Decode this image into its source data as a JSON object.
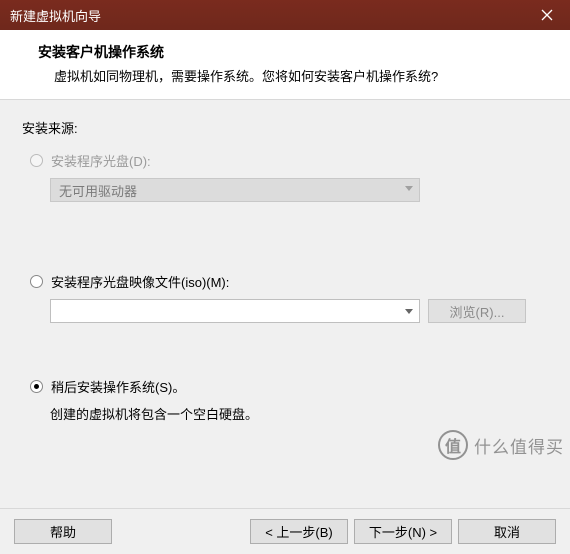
{
  "window": {
    "title": "新建虚拟机向导"
  },
  "header": {
    "title": "安装客户机操作系统",
    "subtitle": "虚拟机如同物理机，需要操作系统。您将如何安装客户机操作系统?"
  },
  "source_label": "安装来源:",
  "options": {
    "disc": {
      "label": "安装程序光盘(D):",
      "dropdown": "无可用驱动器",
      "enabled": false,
      "selected": false
    },
    "iso": {
      "label": "安装程序光盘映像文件(iso)(M):",
      "value": "",
      "browse": "浏览(R)...",
      "selected": false
    },
    "later": {
      "label": "稍后安装操作系统(S)。",
      "hint": "创建的虚拟机将包含一个空白硬盘。",
      "selected": true
    }
  },
  "footer": {
    "help": "帮助",
    "back": "< 上一步(B)",
    "next": "下一步(N) >",
    "cancel": "取消"
  },
  "watermark": {
    "icon": "值",
    "text": "什么值得买"
  }
}
